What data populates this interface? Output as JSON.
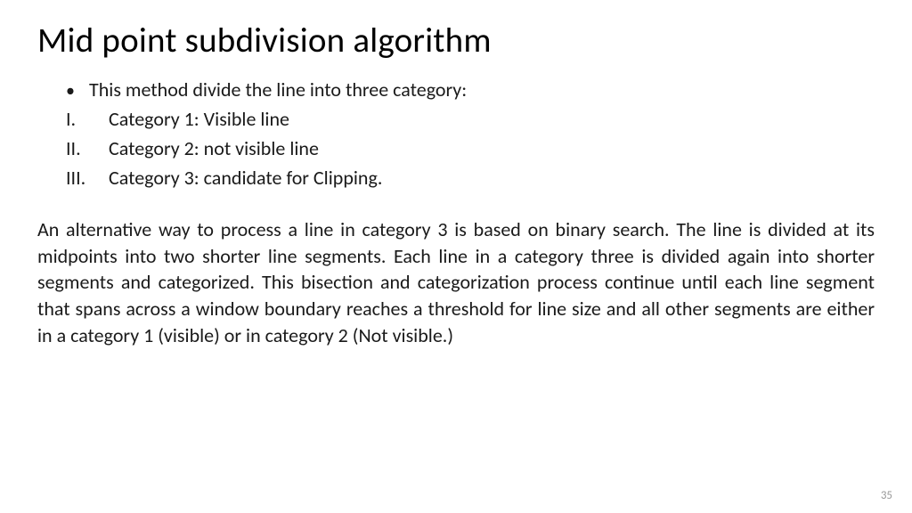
{
  "title": "Mid point  subdivision algorithm",
  "intro_bullet": "This method divide the line into three category:",
  "categories": [
    {
      "marker": "I.",
      "text": "Category 1: Visible line"
    },
    {
      "marker": "II.",
      "text": "Category 2: not visible line"
    },
    {
      "marker": "III.",
      "text": "Category 3: candidate for  Clipping."
    }
  ],
  "paragraph": "An alternative way to process a line in category 3 is based on binary search. The line is divided at its  midpoints into two shorter line segments. Each line in a category three is divided again into shorter segments and categorized. This bisection and categorization process continue until each line segment that spans across a window  boundary reaches a threshold for line size and all other segments are either in  a category 1 (visible) or in category 2 (Not visible.)",
  "page_number": "35"
}
